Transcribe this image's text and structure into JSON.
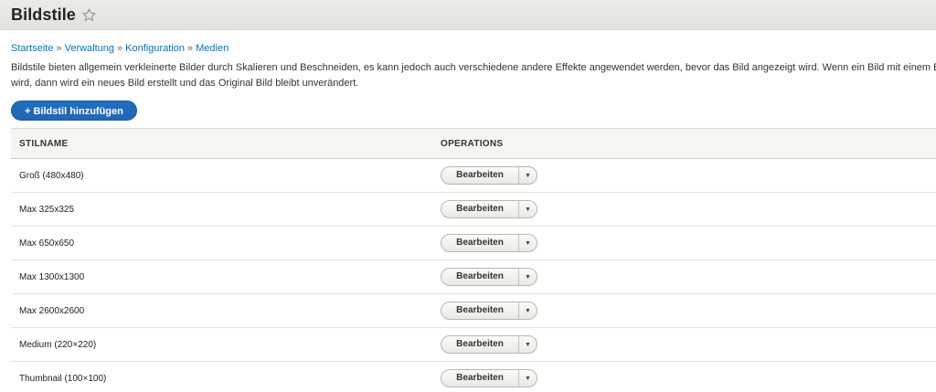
{
  "header": {
    "title": "Bildstile"
  },
  "breadcrumb": [
    "Startseite",
    "Verwaltung",
    "Konfiguration",
    "Medien"
  ],
  "breadcrumb_separator": "»",
  "description": {
    "line1": "Bildstile bieten allgemein verkleinerte Bilder durch Skalieren und Beschneiden, es kann jedoch auch verschiedene andere Effekte angewendet werden, bevor das Bild angezeigt wird. Wenn ein Bild mit einem Bildstil angezeigt",
    "line2": "wird, dann wird ein neues Bild erstellt und das Original Bild bleibt unverändert."
  },
  "add_button": "+ Bildstil hinzufügen",
  "table": {
    "headers": {
      "name": "STILNAME",
      "operations": "OPERATIONS"
    },
    "rows": [
      {
        "name": "Groß (480x480)",
        "action": "Bearbeiten"
      },
      {
        "name": "Max 325x325",
        "action": "Bearbeiten"
      },
      {
        "name": "Max 650x650",
        "action": "Bearbeiten"
      },
      {
        "name": "Max 1300x1300",
        "action": "Bearbeiten"
      },
      {
        "name": "Max 2600x2600",
        "action": "Bearbeiten"
      },
      {
        "name": "Medium (220×220)",
        "action": "Bearbeiten"
      },
      {
        "name": "Thumbnail (100×100)",
        "action": "Bearbeiten"
      }
    ]
  },
  "icons": {
    "favorite": "star-outline-icon",
    "dropdown": "triangle-down-icon"
  },
  "colors": {
    "link": "#0074bd",
    "primary_button": "#2267b3",
    "header_bg": "#e6e5e1"
  }
}
